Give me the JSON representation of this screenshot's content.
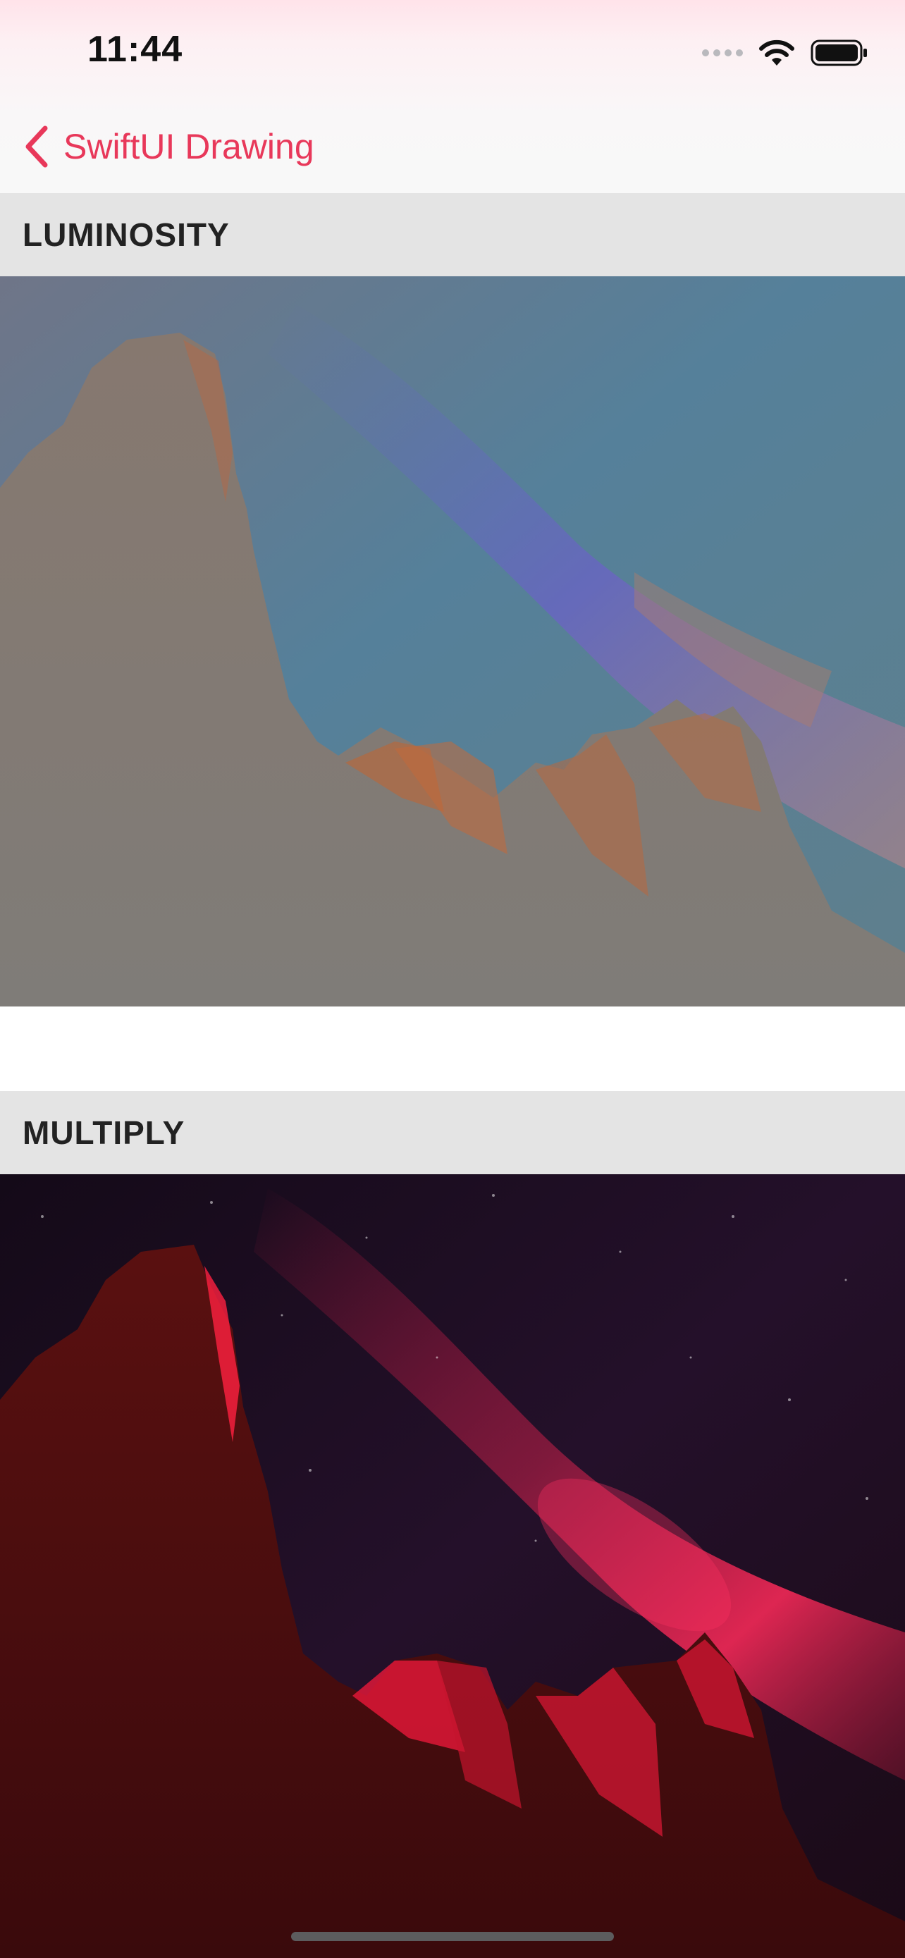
{
  "status_bar": {
    "time": "11:44"
  },
  "nav": {
    "back_label": "SwiftUI Drawing"
  },
  "sections": [
    {
      "title": "LUMINOSITY"
    },
    {
      "title": "MULTIPLY"
    }
  ],
  "colors": {
    "accent": "#e8385a",
    "section_header_bg": "#e4e4e4",
    "multiply_tint": "#ff1e50"
  }
}
